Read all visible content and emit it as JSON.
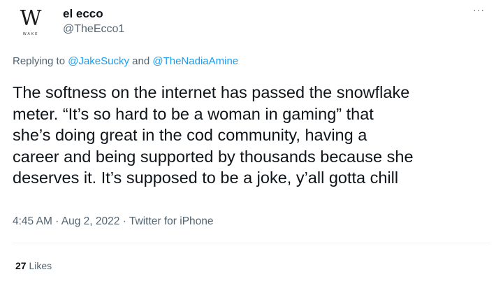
{
  "author": {
    "avatar_logo": "W",
    "avatar_sub": "WAKE",
    "display_name": "el ecco",
    "handle": "@TheEcco1"
  },
  "more_label": "···",
  "reply": {
    "prefix": "Replying to ",
    "mention_1": "@JakeSucky",
    "joiner": " and ",
    "mention_2": "@TheNadiaAmine"
  },
  "tweet": {
    "lines": [
      "The softness on the internet has passed the snowflake",
      "meter. “It’s so hard to be a woman in gaming” that",
      "she’s doing great in the cod community, having a",
      "career and being supported by thousands because she",
      "deserves it. It’s supposed to be a joke, y’all gotta chill"
    ]
  },
  "meta": {
    "time": "4:45 AM",
    "sep1": " · ",
    "date": "Aug 2, 2022",
    "sep2": " · ",
    "source": "Twitter for iPhone"
  },
  "stats": {
    "likes_count": "27",
    "likes_label": " Likes"
  },
  "colors": {
    "link": "#1d9bf0",
    "secondary_text": "#536471",
    "primary_text": "#0f1419"
  }
}
